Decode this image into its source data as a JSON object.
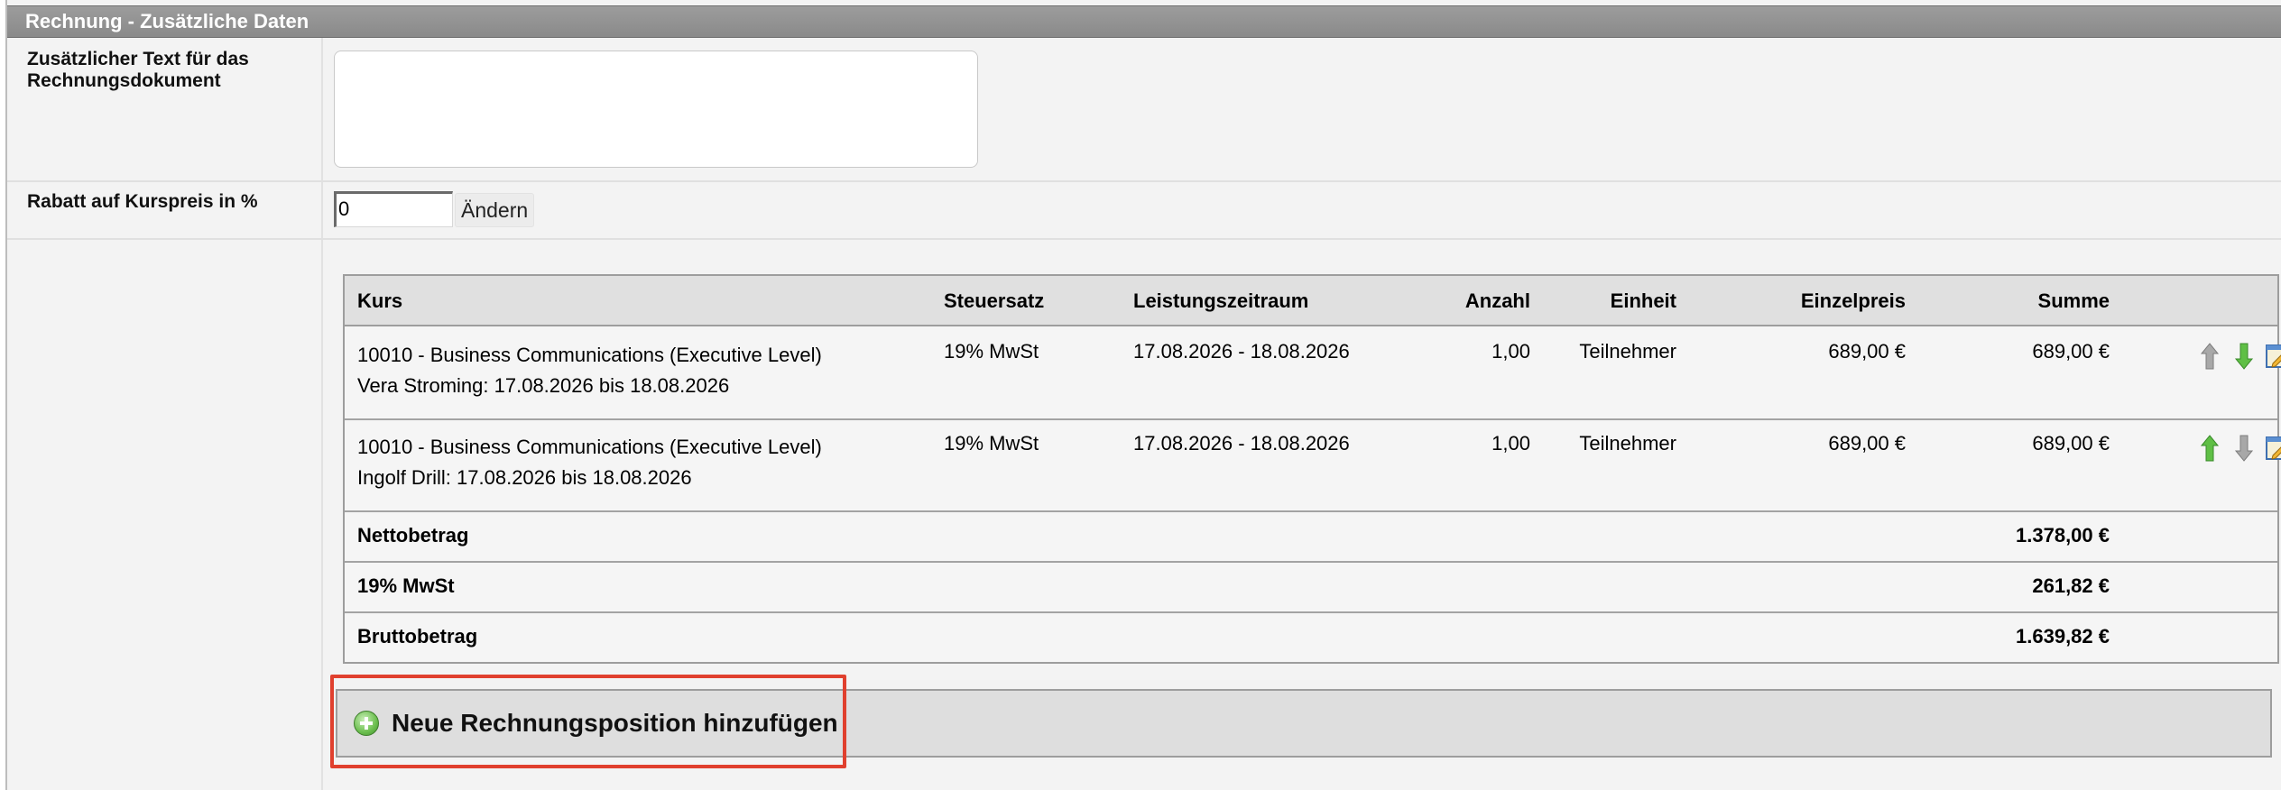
{
  "section": {
    "title": "Rechnung - Zusätzliche Daten"
  },
  "fields": {
    "additional_text": {
      "label_line1": "Zusätzlicher Text für das",
      "label_line2": "Rechnungsdokument",
      "value": ""
    },
    "discount": {
      "label": "Rabatt auf Kurspreis in %",
      "value": "0",
      "button_label": "Ändern"
    }
  },
  "table": {
    "headers": {
      "kurs": "Kurs",
      "steuersatz": "Steuersatz",
      "zeitraum": "Leistungszeitraum",
      "anzahl": "Anzahl",
      "einheit": "Einheit",
      "einzelpreis": "Einzelpreis",
      "summe": "Summe"
    },
    "rows": [
      {
        "kurs": "10010 - Business Communications (Executive Level)",
        "teilnehmer": "Vera Stroming: 17.08.2026 bis 18.08.2026",
        "steuersatz": "19% MwSt",
        "zeitraum": "17.08.2026 - 18.08.2026",
        "anzahl": "1,00",
        "einheit": "Teilnehmer",
        "einzelpreis": "689,00 €",
        "summe": "689,00 €",
        "up_enabled": false,
        "down_enabled": true
      },
      {
        "kurs": "10010 - Business Communications (Executive Level)",
        "teilnehmer": "Ingolf Drill: 17.08.2026 bis 18.08.2026",
        "steuersatz": "19% MwSt",
        "zeitraum": "17.08.2026 - 18.08.2026",
        "anzahl": "1,00",
        "einheit": "Teilnehmer",
        "einzelpreis": "689,00 €",
        "summe": "689,00 €",
        "up_enabled": true,
        "down_enabled": false
      }
    ],
    "totals": [
      {
        "label": "Nettobetrag",
        "value": "1.378,00 €"
      },
      {
        "label": "19% MwSt",
        "value": "261,82 €"
      },
      {
        "label": "Bruttobetrag",
        "value": "1.639,82 €"
      }
    ]
  },
  "actions": {
    "add_position_label": "Neue Rechnungsposition hinzufügen"
  },
  "colors": {
    "highlight": "#e0402e",
    "arrow_active": "#4caf3f",
    "arrow_inactive": "#9a9a9a"
  }
}
